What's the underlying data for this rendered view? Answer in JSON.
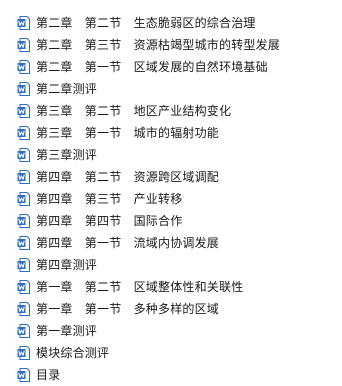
{
  "file_list": {
    "icon": "word-document-icon",
    "icon_color": "#2b6cc4",
    "items": [
      {
        "name": "第二章　第二节　生态脆弱区的综合治理"
      },
      {
        "name": "第二章　第三节　资源枯竭型城市的转型发展"
      },
      {
        "name": "第二章　第一节　区域发展的自然环境基础"
      },
      {
        "name": "第二章测评"
      },
      {
        "name": "第三章　第二节　地区产业结构变化"
      },
      {
        "name": "第三章　第一节　城市的辐射功能"
      },
      {
        "name": "第三章测评"
      },
      {
        "name": "第四章　第二节　资源跨区域调配"
      },
      {
        "name": "第四章　第三节　产业转移"
      },
      {
        "name": "第四章　第四节　国际合作"
      },
      {
        "name": "第四章　第一节　流域内协调发展"
      },
      {
        "name": "第四章测评"
      },
      {
        "name": "第一章　第二节　区域整体性和关联性"
      },
      {
        "name": "第一章　第一节　多种多样的区域"
      },
      {
        "name": "第一章测评"
      },
      {
        "name": "模块综合测评"
      },
      {
        "name": "目录"
      }
    ]
  }
}
